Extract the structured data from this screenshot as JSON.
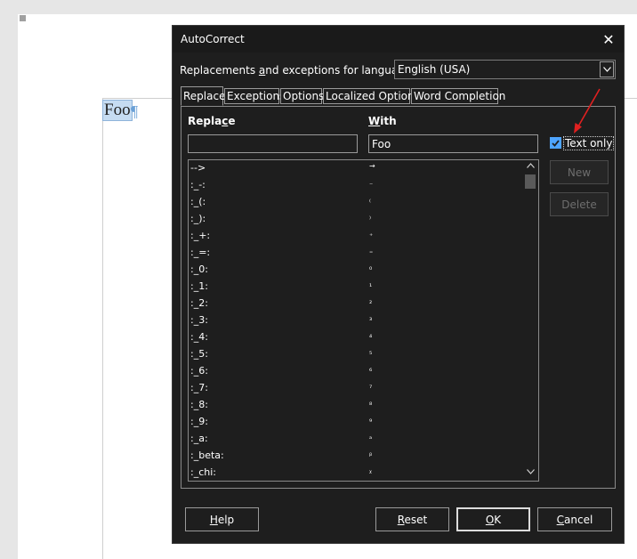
{
  "document": {
    "word": "Foo",
    "pilcrow": "¶"
  },
  "dialog": {
    "title": "AutoCorrect",
    "language_label": "Replacements and exceptions for language:",
    "language_value": "English (USA)",
    "tabs": [
      {
        "label": "Replace",
        "active": true
      },
      {
        "label": "Exceptions",
        "active": false
      },
      {
        "label": "Options",
        "active": false
      },
      {
        "label": "Localized Options",
        "active": false
      },
      {
        "label": "Word Completion",
        "active": false
      }
    ],
    "replace_header": "Replace",
    "with_header": "With",
    "replace_value": "",
    "with_value": "Foo",
    "text_only_label": "Text only",
    "text_only_checked": true,
    "new_label": "New",
    "delete_label": "Delete",
    "rows": [
      {
        "replace": "-->",
        "with": "→"
      },
      {
        "replace": ":_-:",
        "with": "₋"
      },
      {
        "replace": ":_(:",
        "with": "₍"
      },
      {
        "replace": ":_):",
        "with": "₎"
      },
      {
        "replace": ":_+:",
        "with": "₊"
      },
      {
        "replace": ":_=:",
        "with": "₌"
      },
      {
        "replace": ":_0:",
        "with": "₀"
      },
      {
        "replace": ":_1:",
        "with": "₁"
      },
      {
        "replace": ":_2:",
        "with": "₂"
      },
      {
        "replace": ":_3:",
        "with": "₃"
      },
      {
        "replace": ":_4:",
        "with": "₄"
      },
      {
        "replace": ":_5:",
        "with": "₅"
      },
      {
        "replace": ":_6:",
        "with": "₆"
      },
      {
        "replace": ":_7:",
        "with": "₇"
      },
      {
        "replace": ":_8:",
        "with": "₈"
      },
      {
        "replace": ":_9:",
        "with": "₉"
      },
      {
        "replace": ":_a:",
        "with": "ₐ"
      },
      {
        "replace": ":_beta:",
        "with": "ᵦ"
      },
      {
        "replace": ":_chi:",
        "with": "ᵪ"
      }
    ],
    "help_label": "Help",
    "reset_label": "Reset",
    "ok_label": "OK",
    "cancel_label": "Cancel"
  },
  "colors": {
    "dialog_bg": "#1e1e1e",
    "accent": "#4ea4ff",
    "arrow": "#e02020"
  }
}
